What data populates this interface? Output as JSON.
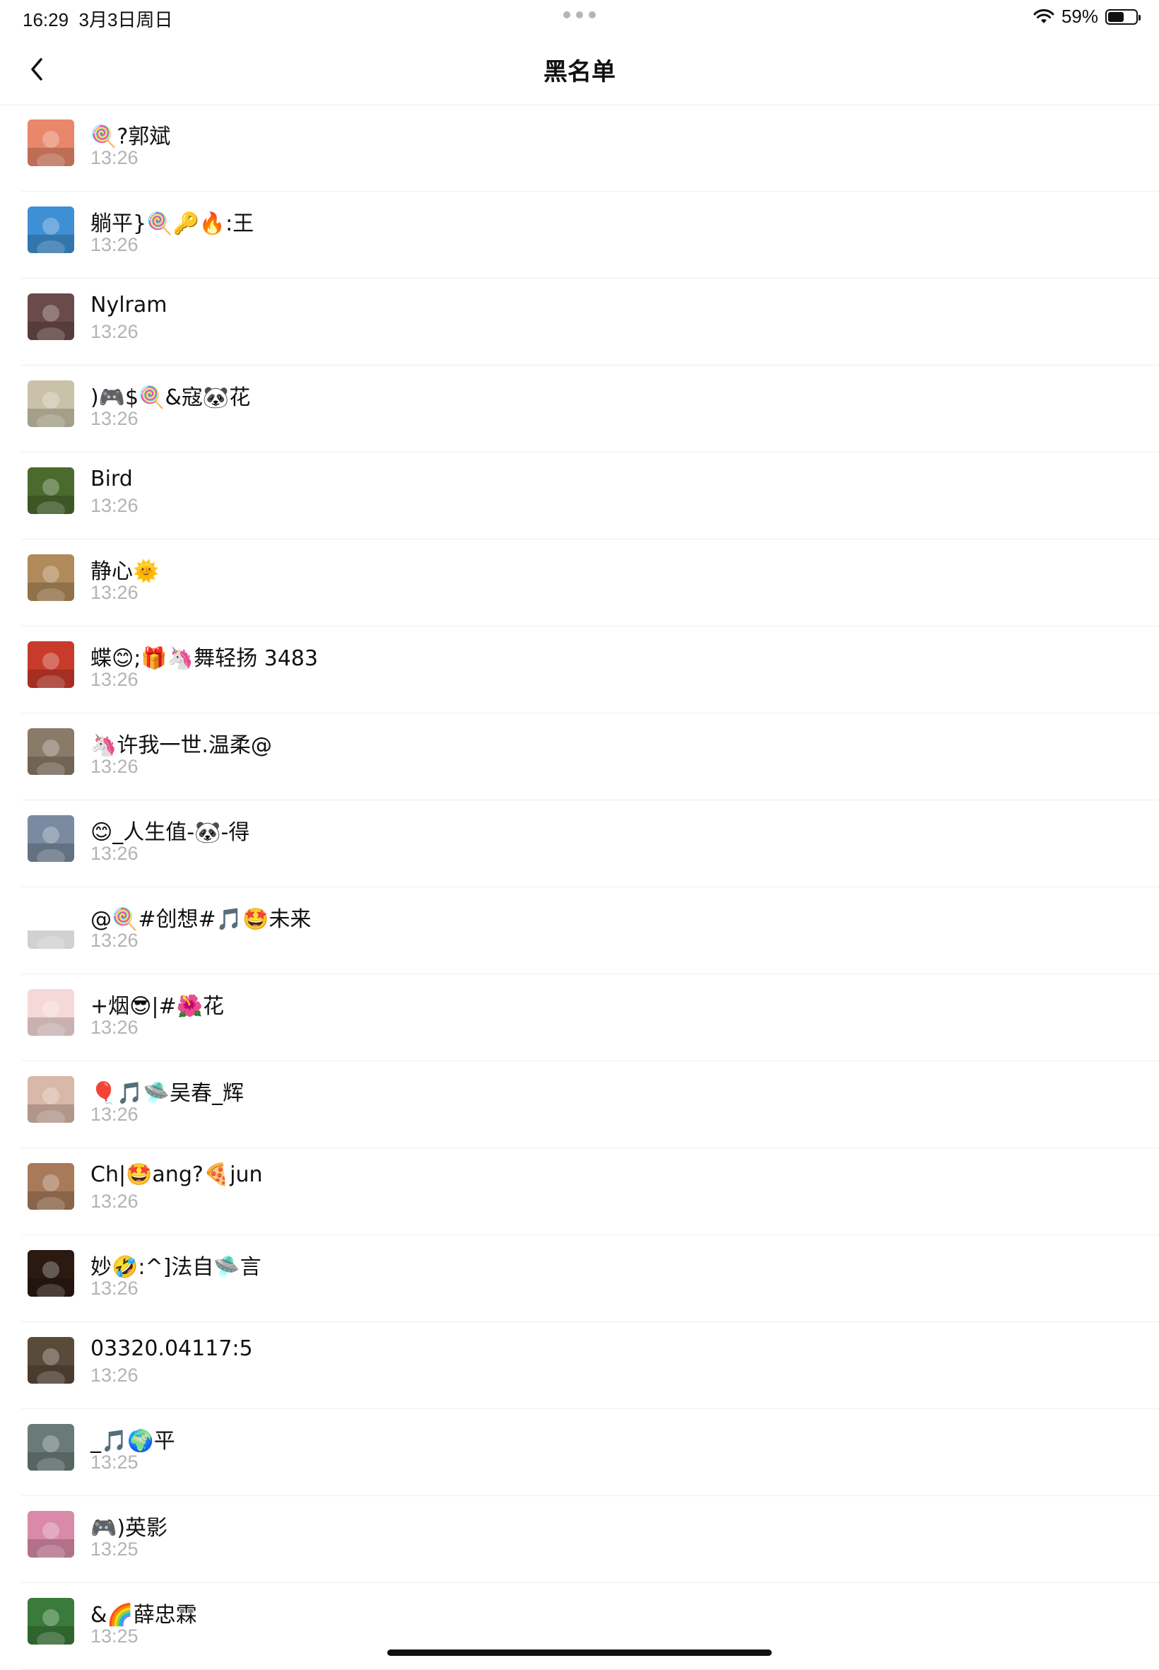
{
  "status_bar": {
    "time": "16:29",
    "date": "3月3日周日",
    "battery_percent": "59%",
    "battery_level": 0.59
  },
  "nav": {
    "title": "黑名单",
    "back_icon": "chevron-left-icon"
  },
  "items": [
    {
      "name": "🍭?郭斌",
      "time": "13:26",
      "avatar_color": "#e8876a"
    },
    {
      "name": "躺平}🍭🔑🔥:王",
      "time": "13:26",
      "avatar_color": "#3f8fd4"
    },
    {
      "name": "Nylram",
      "time": "13:26",
      "avatar_color": "#6b4a4a"
    },
    {
      "name": ")🎮$🍭&寇🐼花",
      "time": "13:26",
      "avatar_color": "#c9c2a8"
    },
    {
      "name": "Bird",
      "time": "13:26",
      "avatar_color": "#4a6a2e"
    },
    {
      "name": "静心🌞",
      "time": "13:26",
      "avatar_color": "#b08a5a"
    },
    {
      "name": "蝶😊;🎁🦄舞轻扬 3483",
      "time": "13:26",
      "avatar_color": "#c83a2a"
    },
    {
      "name": "🦄许我一世.温柔@",
      "time": "13:26",
      "avatar_color": "#8a7a68"
    },
    {
      "name": "😊_人生值-🐼-得",
      "time": "13:26",
      "avatar_color": "#7a8aa0"
    },
    {
      "name": "@🍭#创想#🎵🤩未来",
      "time": "13:26",
      "avatar_color": "#ffffff"
    },
    {
      "name": "+烟😎|#🌺花",
      "time": "13:26",
      "avatar_color": "#f6d8d8"
    },
    {
      "name": "🎈🎵🛸吴春_辉",
      "time": "13:26",
      "avatar_color": "#d8b8a8"
    },
    {
      "name": "Ch|🤩ang?🍕jun",
      "time": "13:26",
      "avatar_color": "#a87a5a"
    },
    {
      "name": "妙🤣:^]法自🛸言",
      "time": "13:26",
      "avatar_color": "#2a1a12"
    },
    {
      "name": "03320.04117:5",
      "time": "13:26",
      "avatar_color": "#5a4a3a"
    },
    {
      "name": "_🎵🌍平",
      "time": "13:25",
      "avatar_color": "#6a7a78"
    },
    {
      "name": "🎮)英影",
      "time": "13:25",
      "avatar_color": "#d88aa8"
    },
    {
      "name": "&🌈薛忠霖",
      "time": "13:25",
      "avatar_color": "#3a7a3a"
    }
  ]
}
